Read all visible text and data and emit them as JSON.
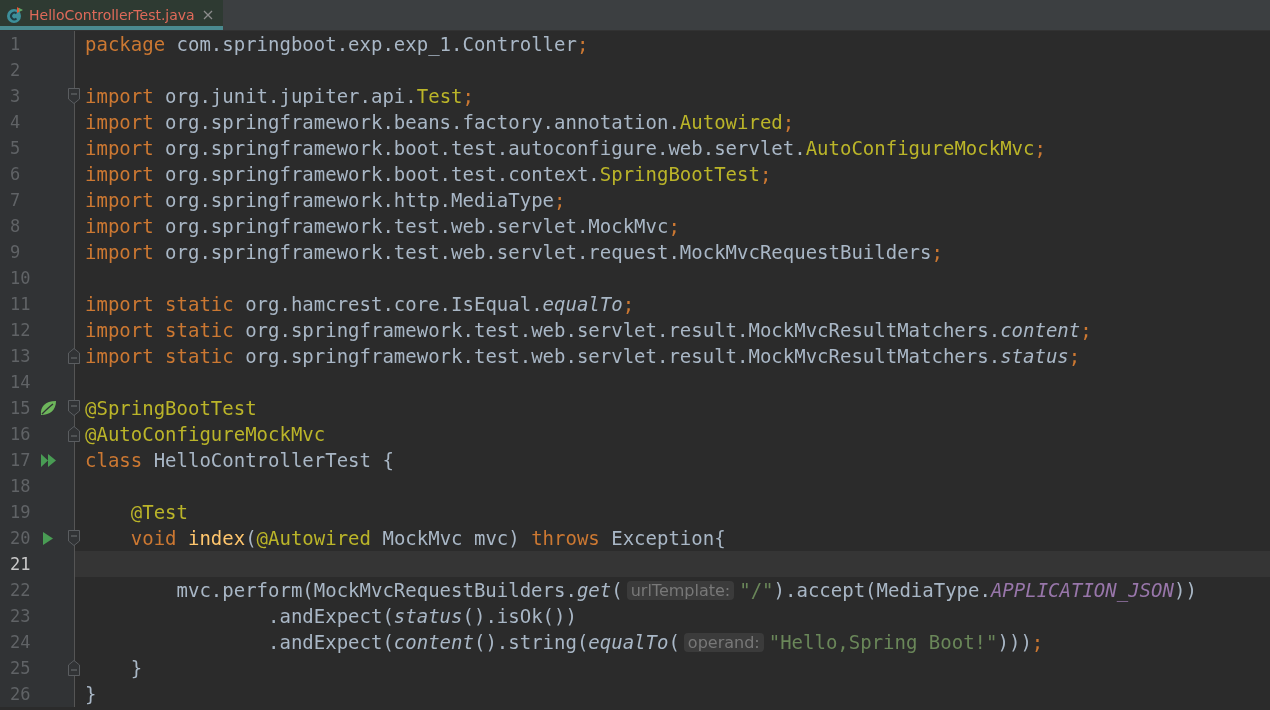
{
  "tabs": [
    {
      "label": "HelloControllerTest.java",
      "selected": true
    }
  ],
  "lines": [
    {
      "n": "1",
      "current": false,
      "tokens": [
        {
          "kind": "kw",
          "text": "package"
        },
        {
          "kind": "plain",
          "text": " com.springboot.exp.exp_1.Controller"
        },
        {
          "kind": "kw",
          "text": ";"
        }
      ]
    },
    {
      "n": "2",
      "current": false
    },
    {
      "n": "3",
      "current": false,
      "fold": {
        "kind": "start"
      },
      "tokens": [
        {
          "kind": "kw",
          "text": "import"
        },
        {
          "kind": "plain",
          "text": " org.junit.jupiter.api."
        },
        {
          "kind": "ann",
          "text": "Test"
        },
        {
          "kind": "kw",
          "text": ";"
        }
      ]
    },
    {
      "n": "4",
      "current": false,
      "tokens": [
        {
          "kind": "kw",
          "text": "import"
        },
        {
          "kind": "plain",
          "text": " org.springframework.beans.factory.annotation."
        },
        {
          "kind": "ann",
          "text": "Autowired"
        },
        {
          "kind": "kw",
          "text": ";"
        }
      ]
    },
    {
      "n": "5",
      "current": false,
      "tokens": [
        {
          "kind": "kw",
          "text": "import"
        },
        {
          "kind": "plain",
          "text": " org.springframework.boot.test.autoconfigure.web.servlet."
        },
        {
          "kind": "ann",
          "text": "AutoConfigureMockMvc"
        },
        {
          "kind": "kw",
          "text": ";"
        }
      ]
    },
    {
      "n": "6",
      "current": false,
      "tokens": [
        {
          "kind": "kw",
          "text": "import"
        },
        {
          "kind": "plain",
          "text": " org.springframework.boot.test.context."
        },
        {
          "kind": "ann",
          "text": "SpringBootTest"
        },
        {
          "kind": "kw",
          "text": ";"
        }
      ]
    },
    {
      "n": "7",
      "current": false,
      "tokens": [
        {
          "kind": "kw",
          "text": "import"
        },
        {
          "kind": "plain",
          "text": " org.springframework.http.MediaType"
        },
        {
          "kind": "kw",
          "text": ";"
        }
      ]
    },
    {
      "n": "8",
      "current": false,
      "tokens": [
        {
          "kind": "kw",
          "text": "import"
        },
        {
          "kind": "plain",
          "text": " org.springframework.test.web.servlet.MockMvc"
        },
        {
          "kind": "kw",
          "text": ";"
        }
      ]
    },
    {
      "n": "9",
      "current": false,
      "tokens": [
        {
          "kind": "kw",
          "text": "import"
        },
        {
          "kind": "plain",
          "text": " org.springframework.test.web.servlet.request.MockMvcRequestBuilders"
        },
        {
          "kind": "kw",
          "text": ";"
        }
      ]
    },
    {
      "n": "10",
      "current": false
    },
    {
      "n": "11",
      "current": false,
      "tokens": [
        {
          "kind": "kw",
          "text": "import static"
        },
        {
          "kind": "plain",
          "text": " org.hamcrest.core.IsEqual."
        },
        {
          "kind": "it",
          "text": "equalTo"
        },
        {
          "kind": "kw",
          "text": ";"
        }
      ]
    },
    {
      "n": "12",
      "current": false,
      "tokens": [
        {
          "kind": "kw",
          "text": "import static"
        },
        {
          "kind": "plain",
          "text": " org.springframework.test.web.servlet.result.MockMvcResultMatchers."
        },
        {
          "kind": "it",
          "text": "content"
        },
        {
          "kind": "kw",
          "text": ";"
        }
      ]
    },
    {
      "n": "13",
      "current": false,
      "fold": {
        "kind": "end"
      },
      "tokens": [
        {
          "kind": "kw",
          "text": "import static"
        },
        {
          "kind": "plain",
          "text": " org.springframework.test.web.servlet.result.MockMvcResultMatchers."
        },
        {
          "kind": "it",
          "text": "status"
        },
        {
          "kind": "kw",
          "text": ";"
        }
      ]
    },
    {
      "n": "14",
      "current": false
    },
    {
      "n": "15",
      "current": false,
      "gutter": {
        "kind": "spring"
      },
      "fold": {
        "kind": "start"
      },
      "tokens": [
        {
          "kind": "ann",
          "text": "@SpringBootTest"
        }
      ]
    },
    {
      "n": "16",
      "current": false,
      "fold": {
        "kind": "end"
      },
      "tokens": [
        {
          "kind": "ann",
          "text": "@AutoConfigureMockMvc"
        }
      ]
    },
    {
      "n": "17",
      "current": false,
      "gutter": {
        "kind": "run-all"
      },
      "tokens": [
        {
          "kind": "kw",
          "text": "class"
        },
        {
          "kind": "plain",
          "text": " HelloControllerTest {"
        }
      ]
    },
    {
      "n": "18",
      "current": false
    },
    {
      "n": "19",
      "current": false,
      "tokens": [
        {
          "kind": "ann",
          "text": "    @Test"
        }
      ]
    },
    {
      "n": "20",
      "current": false,
      "gutter": {
        "kind": "run"
      },
      "fold": {
        "kind": "start"
      },
      "tokens": [
        {
          "kind": "kw",
          "text": "    void "
        },
        {
          "kind": "fn",
          "text": "index"
        },
        {
          "kind": "plain",
          "text": "("
        },
        {
          "kind": "ann",
          "text": "@Autowired"
        },
        {
          "kind": "plain",
          "text": " MockMvc mvc) "
        },
        {
          "kind": "kw",
          "text": "throws"
        },
        {
          "kind": "plain",
          "text": " Exception{"
        }
      ]
    },
    {
      "n": "21",
      "current": true
    },
    {
      "n": "22",
      "current": false,
      "tokens": [
        {
          "kind": "plain",
          "text": "        mvc.perform(MockMvcRequestBuilders."
        },
        {
          "kind": "it",
          "text": "get"
        },
        {
          "kind": "plain",
          "text": "("
        },
        {
          "kind": "hint",
          "text": "urlTemplate:"
        },
        {
          "kind": "str",
          "text": "\"/\""
        },
        {
          "kind": "plain",
          "text": ").accept(MediaType."
        },
        {
          "kind": "const",
          "text": "APPLICATION_JSON"
        },
        {
          "kind": "plain",
          "text": "))"
        }
      ]
    },
    {
      "n": "23",
      "current": false,
      "tokens": [
        {
          "kind": "plain",
          "text": "                .andExpect("
        },
        {
          "kind": "it",
          "text": "status"
        },
        {
          "kind": "plain",
          "text": "().isOk())"
        }
      ]
    },
    {
      "n": "24",
      "current": false,
      "tokens": [
        {
          "kind": "plain",
          "text": "                .andExpect("
        },
        {
          "kind": "it",
          "text": "content"
        },
        {
          "kind": "plain",
          "text": "().string("
        },
        {
          "kind": "it",
          "text": "equalTo"
        },
        {
          "kind": "plain",
          "text": "("
        },
        {
          "kind": "hint",
          "text": "operand:"
        },
        {
          "kind": "str",
          "text": "\"Hello,Spring Boot!\""
        },
        {
          "kind": "plain",
          "text": ")))"
        },
        {
          "kind": "kw",
          "text": ";"
        }
      ]
    },
    {
      "n": "25",
      "current": false,
      "fold": {
        "kind": "end"
      },
      "tokens": [
        {
          "kind": "plain",
          "text": "    }"
        }
      ]
    },
    {
      "n": "26",
      "current": false,
      "tokens": [
        {
          "kind": "plain",
          "text": "}"
        }
      ]
    }
  ]
}
